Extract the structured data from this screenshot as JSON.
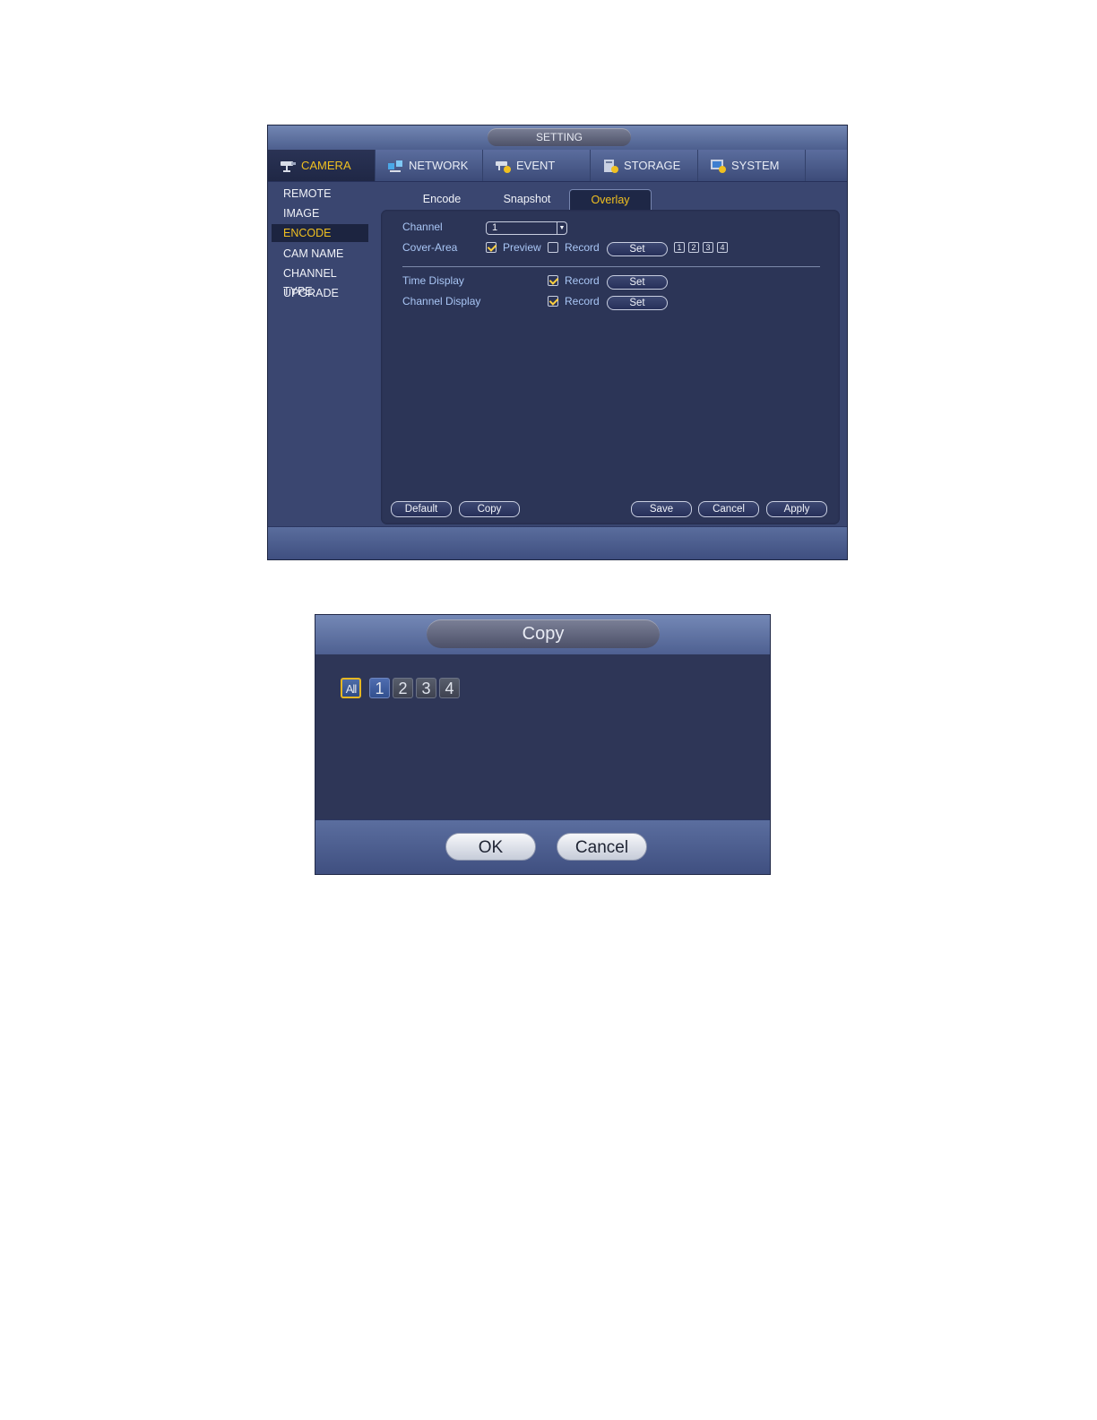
{
  "setting": {
    "title": "SETTING",
    "nav": [
      {
        "label": "CAMERA",
        "icon": "camera-icon"
      },
      {
        "label": "NETWORK",
        "icon": "network-icon"
      },
      {
        "label": "EVENT",
        "icon": "event-icon"
      },
      {
        "label": "STORAGE",
        "icon": "storage-icon"
      },
      {
        "label": "SYSTEM",
        "icon": "system-icon"
      }
    ],
    "sidebar": [
      "REMOTE",
      "IMAGE",
      "ENCODE",
      "CAM NAME",
      "CHANNEL TYPE",
      "UPGRADE"
    ],
    "sub_tabs": [
      "Encode",
      "Snapshot",
      "Overlay"
    ],
    "overlay": {
      "channel_label": "Channel",
      "channel_value": "1",
      "cover_area_label": "Cover-Area",
      "preview_label": "Preview",
      "record_label": "Record",
      "set_label": "Set",
      "area_boxes": [
        "1",
        "2",
        "3",
        "4"
      ],
      "time_display_label": "Time Display",
      "channel_display_label": "Channel Display"
    },
    "buttons": {
      "default": "Default",
      "copy": "Copy",
      "save": "Save",
      "cancel": "Cancel",
      "apply": "Apply"
    }
  },
  "copy_dialog": {
    "title": "Copy",
    "all_label": "All",
    "channels": [
      "1",
      "2",
      "3",
      "4"
    ],
    "ok": "OK",
    "cancel": "Cancel"
  },
  "colors": {
    "accent": "#f0c020",
    "label_blue": "#a9c6f5",
    "panel_bg": "#2c3557"
  }
}
